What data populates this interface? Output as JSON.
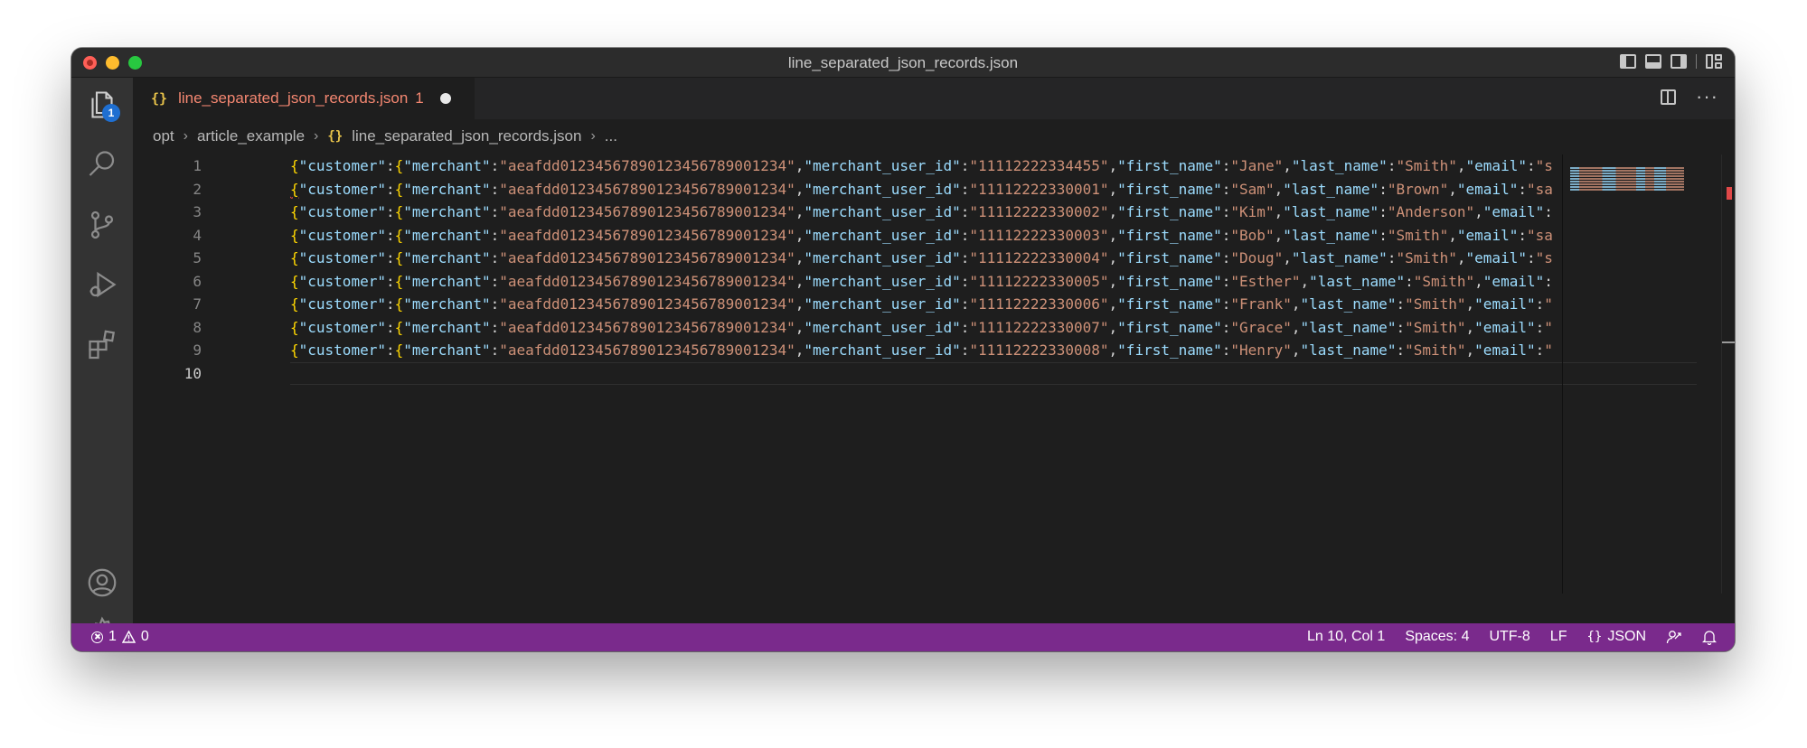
{
  "window": {
    "title": "line_separated_json_records.json"
  },
  "activity_bar": {
    "explorer_badge": "1"
  },
  "tab": {
    "icon": "{}",
    "label": "line_separated_json_records.json",
    "problem_count": "1",
    "dirty": true
  },
  "breadcrumb": {
    "segments": [
      "opt",
      "article_example",
      "line_separated_json_records.json",
      "..."
    ],
    "file_icon": "{}"
  },
  "editor": {
    "line_numbers": [
      "1",
      "2",
      "3",
      "4",
      "5",
      "6",
      "7",
      "8",
      "9",
      "10"
    ],
    "current_line": "10",
    "lines": [
      [
        "{",
        "\"customer\"",
        ":",
        "{",
        "\"merchant\"",
        ":",
        "\"aeafdd0123456789012345678900123​4\"",
        ",",
        "\"merchant_user_id\"",
        ":",
        "\"11112222334455\"",
        ",",
        "\"first_name\"",
        ":",
        "\"Jane\"",
        ",",
        "\"last_name\"",
        ":",
        "\"Smith\"",
        ",",
        "\"email\"",
        ":",
        "\"s"
      ],
      [],
      [],
      [],
      [],
      [],
      [],
      [],
      [],
      []
    ],
    "records": [
      {
        "merchant": "\"aeafdd01234567890123456789001234\"",
        "merchant_user_id": "\"11112222334455\"",
        "first_name": "\"Jane\"",
        "last_name": "\"Smith\"",
        "tail": "\"s"
      },
      {
        "merchant": "\"aeafdd01234567890123456789001234\"",
        "merchant_user_id": "\"11112222330001\"",
        "first_name": "\"Sam\"",
        "last_name": "\"Brown\"",
        "tail": "\"sa"
      },
      {
        "merchant": "\"aeafdd01234567890123456789001234\"",
        "merchant_user_id": "\"11112222330002\"",
        "first_name": "\"Kim\"",
        "last_name": "\"Anderson\"",
        "tail": ""
      },
      {
        "merchant": "\"aeafdd01234567890123456789001234\"",
        "merchant_user_id": "\"11112222330003\"",
        "first_name": "\"Bob\"",
        "last_name": "\"Smith\"",
        "tail": "\"sa"
      },
      {
        "merchant": "\"aeafdd01234567890123456789001234\"",
        "merchant_user_id": "\"11112222330004\"",
        "first_name": "\"Doug\"",
        "last_name": "\"Smith\"",
        "tail": "\"s"
      },
      {
        "merchant": "\"aeafdd01234567890123456789001234\"",
        "merchant_user_id": "\"11112222330005\"",
        "first_name": "\"Esther\"",
        "last_name": "\"Smith\"",
        "tail": ""
      },
      {
        "merchant": "\"aeafdd01234567890123456789001234\"",
        "merchant_user_id": "\"11112222330006\"",
        "first_name": "\"Frank\"",
        "last_name": "\"Smith\"",
        "tail": "\""
      },
      {
        "merchant": "\"aeafdd01234567890123456789001234\"",
        "merchant_user_id": "\"11112222330007\"",
        "first_name": "\"Grace\"",
        "last_name": "\"Smith\"",
        "tail": "\""
      },
      {
        "merchant": "\"aeafdd01234567890123456789001234\"",
        "merchant_user_id": "\"11112222330008\"",
        "first_name": "\"Henry\"",
        "last_name": "\"Smith\"",
        "tail": "\""
      }
    ],
    "key_names": {
      "customer": "\"customer\"",
      "merchant": "\"merchant\"",
      "merchant_user_id": "\"merchant_user_id\"",
      "first_name": "\"first_name\"",
      "last_name": "\"last_name\"",
      "email": "\"email\""
    }
  },
  "status_bar": {
    "errors": "1",
    "warnings": "0",
    "position": "Ln 10, Col 1",
    "indent": "Spaces: 4",
    "encoding": "UTF-8",
    "eol": "LF",
    "language_icon": "{}",
    "language": "JSON"
  },
  "colors": {
    "status_bar": "#7a2a8c",
    "tab_label": "#f48771",
    "string": "#ce9178",
    "key": "#9cdcfe",
    "brace": "#ffd700"
  }
}
